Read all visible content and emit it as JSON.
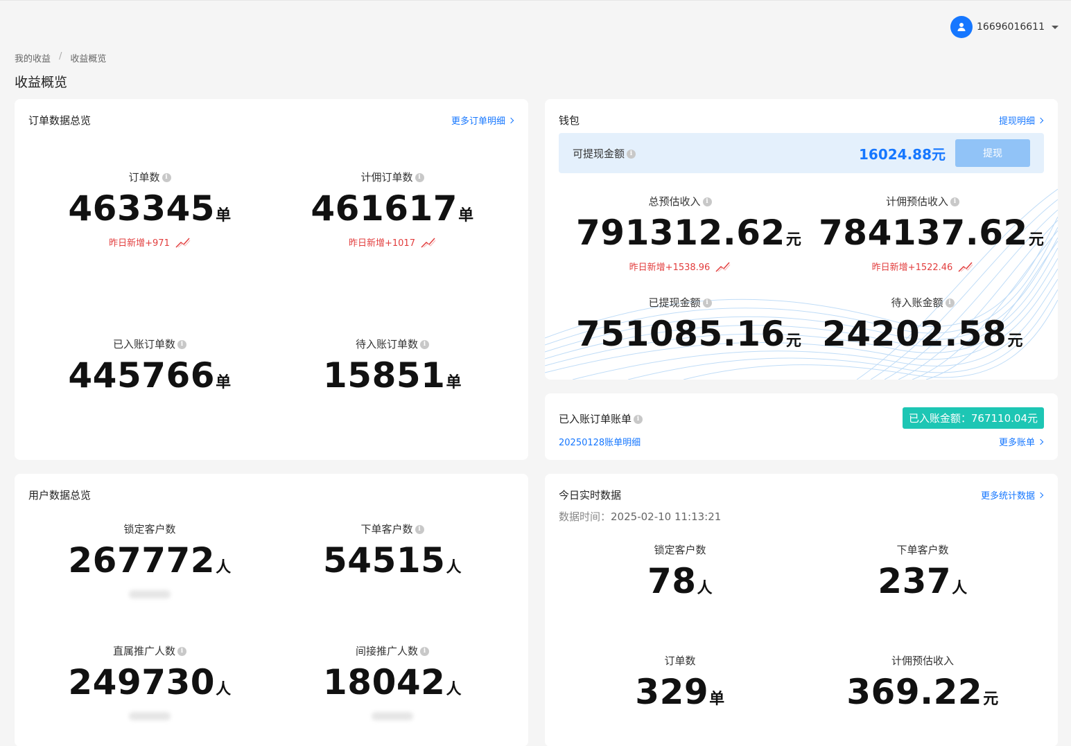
{
  "header": {
    "user": "16696016611"
  },
  "breadcrumb": {
    "root": "我的收益",
    "sep": "/",
    "current": "收益概览"
  },
  "page_title": "收益概览",
  "orders": {
    "title": "订单数据总览",
    "link": "更多订单明细",
    "stats": [
      {
        "label": "订单数",
        "value": "463345",
        "unit": "单",
        "inc": "昨日新增+971"
      },
      {
        "label": "计佣订单数",
        "value": "461617",
        "unit": "单",
        "inc": "昨日新增+1017"
      },
      {
        "label": "已入账订单数",
        "value": "445766",
        "unit": "单"
      },
      {
        "label": "待入账订单数",
        "value": "15851",
        "unit": "单"
      }
    ]
  },
  "wallet": {
    "title": "钱包",
    "link": "提现明细",
    "available_label": "可提现金额",
    "available_value": "16024.88元",
    "withdraw_label": "提现",
    "stats": [
      {
        "label": "总预估收入",
        "value": "791312.62",
        "unit": "元",
        "inc": "昨日新增+1538.96"
      },
      {
        "label": "计佣预估收入",
        "value": "784137.62",
        "unit": "元",
        "inc": "昨日新增+1522.46"
      },
      {
        "label": "已提现金额",
        "value": "751085.16",
        "unit": "元"
      },
      {
        "label": "待入账金额",
        "value": "24202.58",
        "unit": "元"
      }
    ]
  },
  "bill": {
    "title": "已入账订单账单",
    "amount_tag": "已入账金额：767110.04元",
    "detail_link": "20250128账单明细",
    "more_link": "更多账单"
  },
  "users": {
    "title": "用户数据总览",
    "stats": [
      {
        "label": "锁定客户数",
        "value": "267772",
        "unit": "人"
      },
      {
        "label": "下单客户数",
        "value": "54515",
        "unit": "人"
      },
      {
        "label": "直属推广人数",
        "value": "249730",
        "unit": "人"
      },
      {
        "label": "间接推广人数",
        "value": "18042",
        "unit": "人"
      }
    ]
  },
  "today": {
    "title": "今日实时数据",
    "link": "更多统计数据",
    "time_label": "数据时间：",
    "time_value": "2025-02-10 11:13:21",
    "stats": [
      {
        "label": "锁定客户数",
        "value": "78",
        "unit": "人"
      },
      {
        "label": "下单客户数",
        "value": "237",
        "unit": "人"
      },
      {
        "label": "订单数",
        "value": "329",
        "unit": "单"
      },
      {
        "label": "计佣预估收入",
        "value": "369.22",
        "unit": "元"
      }
    ]
  },
  "colors": {
    "accent": "#1677ff",
    "increase": "#e23d3d",
    "tag": "#1dc6b4"
  }
}
